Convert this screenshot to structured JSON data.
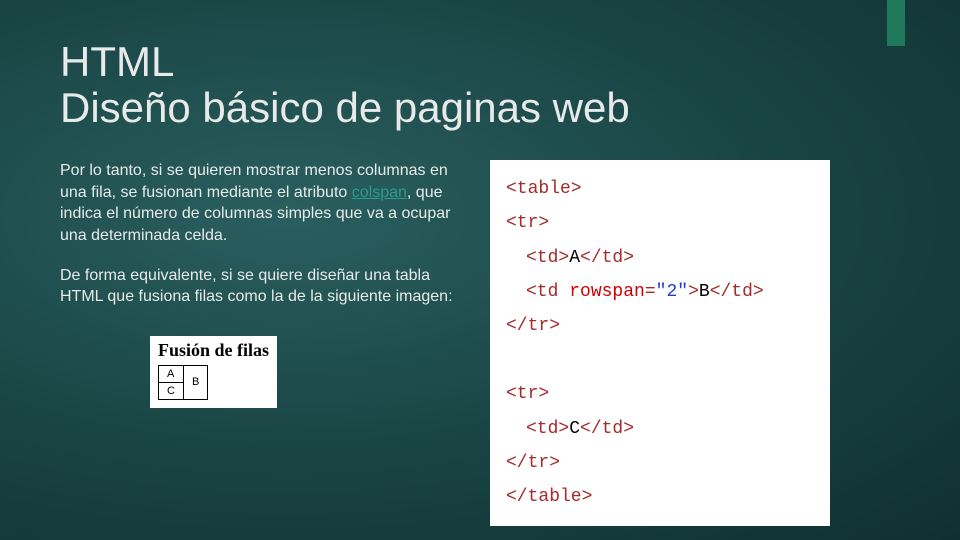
{
  "title": {
    "line1": "HTML",
    "line2": "Diseño básico de paginas web"
  },
  "paragraphs": {
    "p1_a": "Por lo tanto, si se quieren mostrar menos columnas en una fila, se fusionan mediante el atributo ",
    "p1_colspan": "colspan",
    "p1_b": ", que indica el número de columnas simples que va a ocupar una determinada celda.",
    "p2": "De forma equivalente, si se quiere diseñar una tabla HTML que fusiona filas como la de la siguiente imagen:"
  },
  "figure": {
    "caption": "Fusión de filas",
    "cells": {
      "a": "A",
      "b": "B",
      "c": "C"
    }
  },
  "code": {
    "table_open": "<table>",
    "tr_open": "<tr>",
    "td_a_open": "<td>",
    "td_a_text": "A",
    "td_a_close": "</td>",
    "td_b_open1": "<td ",
    "td_b_attr": "rowspan",
    "td_b_eq": "=",
    "td_b_val": "\"2\"",
    "td_b_open2": ">",
    "td_b_text": "B",
    "td_b_close": "</td>",
    "tr_close": "</tr>",
    "td_c_open": "<td>",
    "td_c_text": "C",
    "td_c_close": "</td>",
    "table_close": "</table>"
  }
}
